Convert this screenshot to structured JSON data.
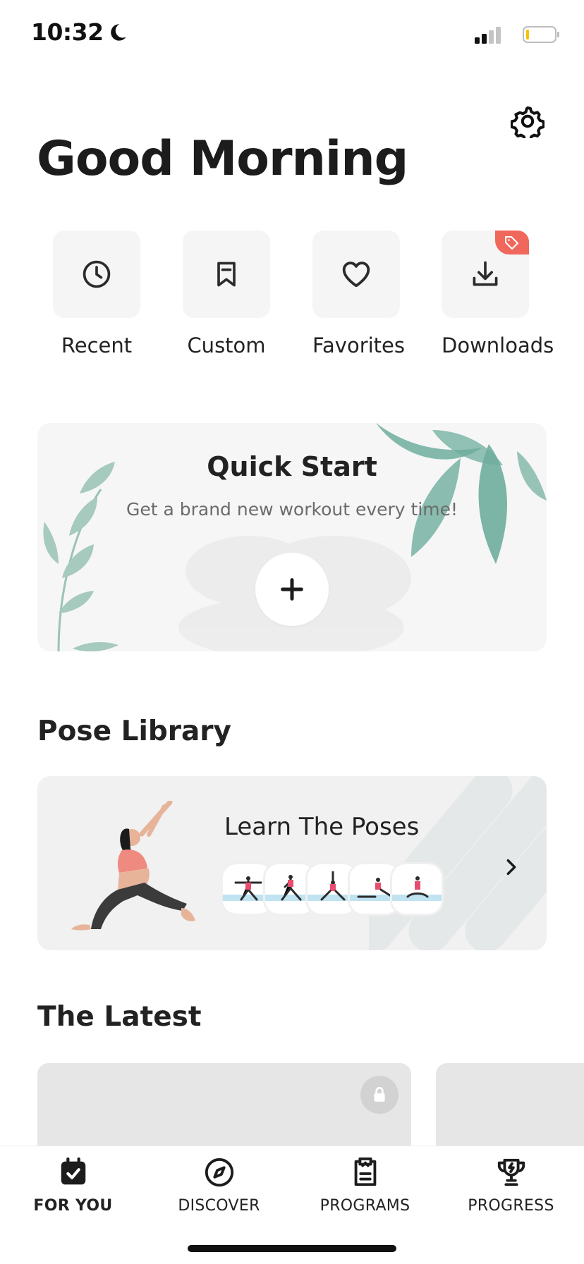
{
  "status_bar": {
    "time": "10:32"
  },
  "header": {
    "greeting": "Good Morning",
    "settings_icon": "gear-icon"
  },
  "quick_actions": [
    {
      "label": "Recent",
      "icon": "clock-icon"
    },
    {
      "label": "Custom",
      "icon": "bookmark-icon"
    },
    {
      "label": "Favorites",
      "icon": "heart-icon"
    },
    {
      "label": "Downloads",
      "icon": "download-icon",
      "badge_icon": "tag-icon"
    }
  ],
  "quick_start": {
    "title": "Quick Start",
    "subtitle": "Get a brand new workout every time!",
    "action_icon": "plus-icon"
  },
  "pose_library": {
    "section_title": "Pose Library",
    "card_title": "Learn The Poses"
  },
  "latest": {
    "section_title": "The Latest",
    "locked_icon": "lock-icon"
  },
  "tab_bar": {
    "tabs": [
      {
        "label": "FOR YOU",
        "icon": "calendar-check-icon",
        "active": true
      },
      {
        "label": "DISCOVER",
        "icon": "compass-icon",
        "active": false
      },
      {
        "label": "PROGRAMS",
        "icon": "clipboard-icon",
        "active": false
      },
      {
        "label": "PROGRESS",
        "icon": "trophy-icon",
        "active": false
      }
    ]
  },
  "colors": {
    "accent_tag": "#f0675c",
    "leaf": "#5fa493",
    "battery_level": "#f5c400"
  }
}
